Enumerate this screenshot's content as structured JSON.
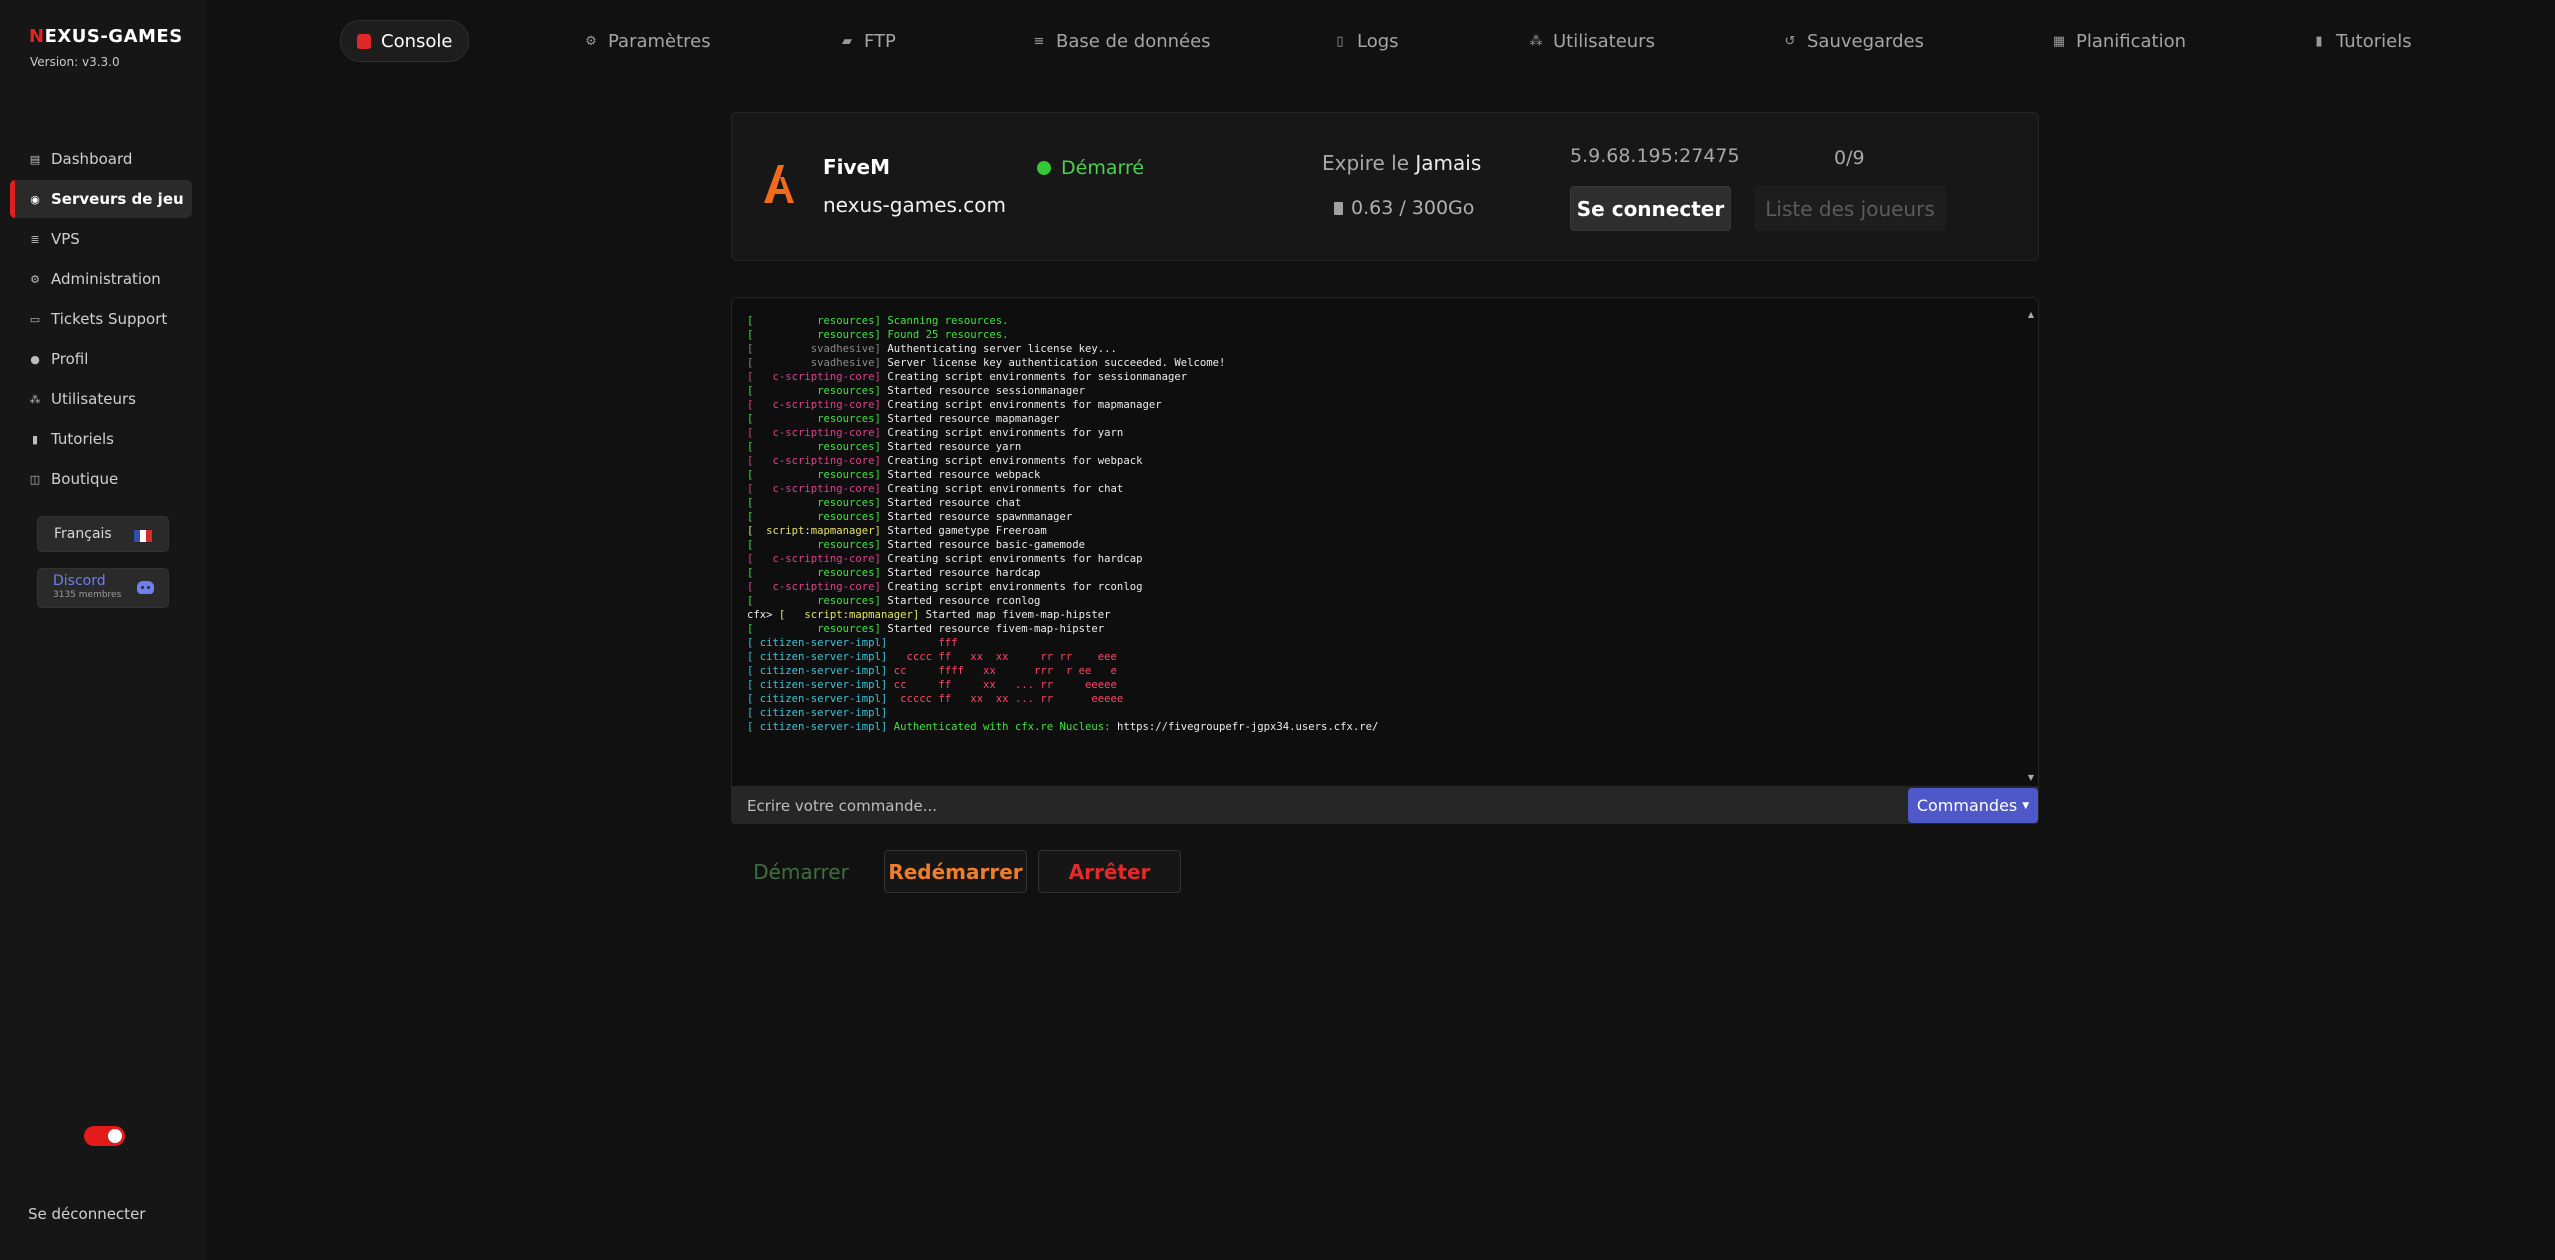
{
  "brand": {
    "name_prefix": "N",
    "name_rest": "EXUS-GAMES",
    "version": "Version: v3.3.0"
  },
  "sidebar": {
    "items": [
      {
        "label": "Dashboard",
        "icon": "dashboard-icon"
      },
      {
        "label": "Serveurs de jeu",
        "icon": "gamepad-icon",
        "active": true
      },
      {
        "label": "VPS",
        "icon": "server-icon"
      },
      {
        "label": "Administration",
        "icon": "gear-icon"
      },
      {
        "label": "Tickets Support",
        "icon": "ticket-icon"
      },
      {
        "label": "Profil",
        "icon": "user-icon"
      },
      {
        "label": "Utilisateurs",
        "icon": "users-icon"
      },
      {
        "label": "Tutoriels",
        "icon": "book-icon"
      },
      {
        "label": "Boutique",
        "icon": "cart-icon"
      }
    ],
    "language": "Français",
    "discord": {
      "label": "Discord",
      "members": "3135 membres"
    },
    "logout": "Se déconnecter"
  },
  "tabs": [
    {
      "label": "Console",
      "icon": "console-icon",
      "active": true
    },
    {
      "label": "Paramètres",
      "icon": "gear-icon"
    },
    {
      "label": "FTP",
      "icon": "folder-icon"
    },
    {
      "label": "Base de données",
      "icon": "database-icon"
    },
    {
      "label": "Logs",
      "icon": "file-icon"
    },
    {
      "label": "Utilisateurs",
      "icon": "users-icon"
    },
    {
      "label": "Sauvegardes",
      "icon": "history-icon"
    },
    {
      "label": "Planification",
      "icon": "calendar-icon"
    },
    {
      "label": "Tutoriels",
      "icon": "book-icon"
    }
  ],
  "server": {
    "game": "FiveM",
    "host": "nexus-games.com",
    "status": "Démarré",
    "expire_label": "Expire le",
    "expire_value": "Jamais",
    "disk": "0.63 / 300Go",
    "ip": "5.9.68.195:27475",
    "players": "0/9",
    "connect_label": "Se connecter",
    "players_list_label": "Liste des joueurs"
  },
  "console": {
    "lines": [
      [
        [
          "g",
          "[          resources] "
        ],
        [
          "g",
          "Scanning resources."
        ]
      ],
      [
        [
          "g",
          "[          resources] "
        ],
        [
          "g",
          "Found 25 resources."
        ]
      ],
      [
        [
          "gy",
          "[         svadhesive] "
        ],
        [
          "w",
          "Authenticating server license key..."
        ]
      ],
      [
        [
          "gy",
          "[         svadhesive] "
        ],
        [
          "w",
          "Server license key authentication succeeded. Welcome!"
        ]
      ],
      [
        [
          "r",
          "[   c-scripting-core] "
        ],
        [
          "w",
          "Creating script environments for sessionmanager"
        ]
      ],
      [
        [
          "g",
          "[          resources] "
        ],
        [
          "w",
          "Started resource sessionmanager"
        ]
      ],
      [
        [
          "r",
          "[   c-scripting-core] "
        ],
        [
          "w",
          "Creating script environments for mapmanager"
        ]
      ],
      [
        [
          "g",
          "[          resources] "
        ],
        [
          "w",
          "Started resource mapmanager"
        ]
      ],
      [
        [
          "r",
          "[   c-scripting-core] "
        ],
        [
          "w",
          "Creating script environments for yarn"
        ]
      ],
      [
        [
          "g",
          "[          resources] "
        ],
        [
          "w",
          "Started resource yarn"
        ]
      ],
      [
        [
          "r",
          "[   c-scripting-core] "
        ],
        [
          "w",
          "Creating script environments for webpack"
        ]
      ],
      [
        [
          "g",
          "[          resources] "
        ],
        [
          "w",
          "Started resource webpack"
        ]
      ],
      [
        [
          "r",
          "[   c-scripting-core] "
        ],
        [
          "w",
          "Creating script environments for chat"
        ]
      ],
      [
        [
          "g",
          "[          resources] "
        ],
        [
          "w",
          "Started resource chat"
        ]
      ],
      [
        [
          "g",
          "[          resources] "
        ],
        [
          "w",
          "Started resource spawnmanager"
        ]
      ],
      [
        [
          "y",
          "[  script:mapmanager] "
        ],
        [
          "w",
          "Started gametype Freeroam"
        ]
      ],
      [
        [
          "g",
          "[          resources] "
        ],
        [
          "w",
          "Started resource basic-gamemode"
        ]
      ],
      [
        [
          "r",
          "[   c-scripting-core] "
        ],
        [
          "w",
          "Creating script environments for hardcap"
        ]
      ],
      [
        [
          "g",
          "[          resources] "
        ],
        [
          "w",
          "Started resource hardcap"
        ]
      ],
      [
        [
          "r",
          "[   c-scripting-core] "
        ],
        [
          "w",
          "Creating script environments for rconlog"
        ]
      ],
      [
        [
          "g",
          "[          resources] "
        ],
        [
          "w",
          "Started resource rconlog"
        ]
      ],
      [
        [
          "w",
          "cfx> "
        ],
        [
          "y",
          "[   script:mapmanager] "
        ],
        [
          "w",
          "Started map fivem-map-hipster"
        ]
      ],
      [
        [
          "g",
          "[          resources] "
        ],
        [
          "w",
          "Started resource fivem-map-hipster"
        ]
      ],
      [
        [
          "c",
          "[ citizen-server-impl] "
        ],
        [
          "pk",
          "       fff"
        ]
      ],
      [
        [
          "c",
          "[ citizen-server-impl] "
        ],
        [
          "pk",
          "  cccc ff   xx  xx     rr rr    eee"
        ]
      ],
      [
        [
          "c",
          "[ citizen-server-impl] "
        ],
        [
          "pk",
          "cc     ffff   xx      rrr  r ee   e"
        ]
      ],
      [
        [
          "c",
          "[ citizen-server-impl] "
        ],
        [
          "pk",
          "cc     ff     xx   ... rr     eeeee"
        ]
      ],
      [
        [
          "c",
          "[ citizen-server-impl] "
        ],
        [
          "pk",
          " ccccc ff   xx  xx ... rr      eeeee"
        ]
      ],
      [
        [
          "c",
          "[ citizen-server-impl] "
        ],
        [
          "pk",
          ""
        ]
      ],
      [
        [
          "c",
          "[ citizen-server-impl] "
        ],
        [
          "g",
          "Authenticated with cfx.re Nucleus: "
        ],
        [
          "w",
          "https://fivegroupefr-jgpx34.users.cfx.re/"
        ]
      ]
    ],
    "input_placeholder": "Ecrire votre commande...",
    "commands_label": "Commandes"
  },
  "actions": {
    "start": "Démarrer",
    "restart": "Redémarrer",
    "stop": "Arrêter"
  },
  "colors": {
    "accent_red": "#e02020",
    "status_green": "#4bd14b",
    "commands_blue": "#4f58c9",
    "restart_orange": "#f07d2a"
  }
}
